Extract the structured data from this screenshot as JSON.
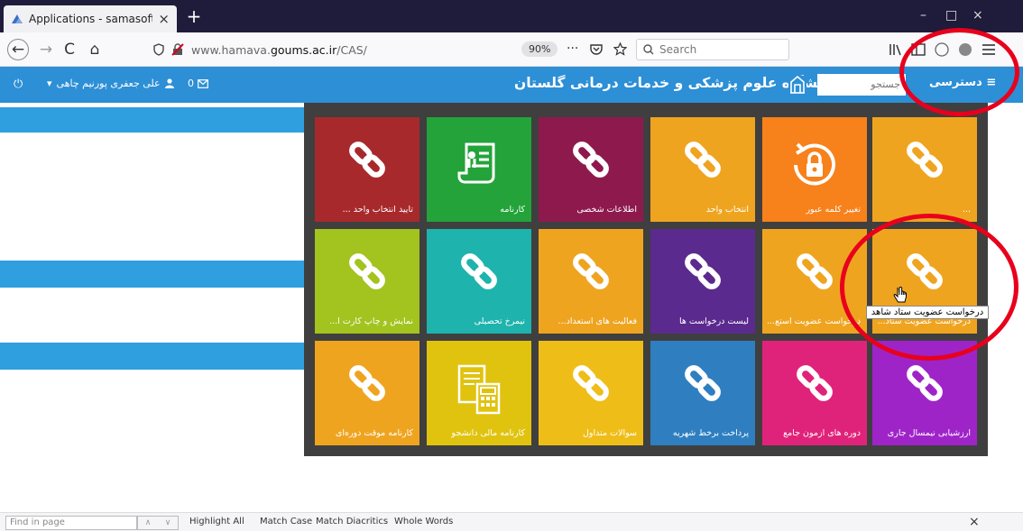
{
  "browser": {
    "tab_title": "Applications - samasoft",
    "tab_close": "×",
    "new_tab": "+",
    "window_controls": [
      "–",
      "□",
      "×"
    ],
    "nav_glyphs": {
      "back": "←",
      "forward": "→",
      "reload": "C",
      "home": "⌂"
    },
    "url_prefix": "www.hamava.",
    "url_domain": "goums.ac.ir",
    "url_path": "/CAS/",
    "zoom": "90%",
    "page_actions": "···",
    "search_placeholder": "Search"
  },
  "header": {
    "title": "دانشگاه علوم پزشکی و خدمات درمانی گلستان",
    "search_placeholder": "جستجو",
    "access_label": "دسترسی",
    "user_name": "علی جعفری پورنیم چاهی",
    "message_count": "0",
    "colors": {
      "bar": "#2d8fd6",
      "page_bars": "#2f9fe0"
    }
  },
  "tiles": [
    {
      "label": "...",
      "color": "#efa420",
      "icon": "link-icon"
    },
    {
      "label": "تغییر کلمه عبور",
      "color": "#f7811b",
      "icon": "lock-icon"
    },
    {
      "label": "انتخاب واحد",
      "color": "#efa420",
      "icon": "link-icon"
    },
    {
      "label": "اطلاعات شخصی",
      "color": "#8e1a4d",
      "icon": "link-icon"
    },
    {
      "label": "کارنامه",
      "color": "#23a33a",
      "icon": "document-icon"
    },
    {
      "label": "تایید انتخاب واحد ...",
      "color": "#a8292c",
      "icon": "link-icon"
    },
    {
      "label": "درخواست عضویت ستاد...",
      "color": "#efa420",
      "icon": "link-icon"
    },
    {
      "label": "درخواست عضویت استع...",
      "color": "#efa420",
      "icon": "link-icon"
    },
    {
      "label": "لیست درخواست ها",
      "color": "#5b2a8f",
      "icon": "link-icon"
    },
    {
      "label": "فعالیت های استعداد...",
      "color": "#efa420",
      "icon": "link-icon"
    },
    {
      "label": "نیمرخ تحصیلی",
      "color": "#1eb3ad",
      "icon": "link-icon"
    },
    {
      "label": "نمایش و چاپ کارت ا...",
      "color": "#a3c31f",
      "icon": "link-icon"
    },
    {
      "label": "ارزشیابی نیمسال جاری",
      "color": "#9f24c8",
      "icon": "link-icon"
    },
    {
      "label": "دوره های آزمون جامع",
      "color": "#e0237a",
      "icon": "link-icon"
    },
    {
      "label": "پرداخت برخط شهریه",
      "color": "#2f7fc0",
      "icon": "link-icon"
    },
    {
      "label": "سوالات متداول",
      "color": "#efbd17",
      "icon": "link-icon"
    },
    {
      "label": "کارنامه مالی دانشجو",
      "color": "#e0c30f",
      "icon": "calculator-icon"
    },
    {
      "label": "کارنامه موقت دوره‌ای",
      "color": "#efa420",
      "icon": "link-icon"
    }
  ],
  "tooltip": "درخواست عضویت ستاد شاهد",
  "findbar": {
    "placeholder": "Find in page",
    "options": [
      "Highlight All",
      "Match Case",
      "Match Diacritics",
      "Whole Words"
    ],
    "close": "×"
  }
}
